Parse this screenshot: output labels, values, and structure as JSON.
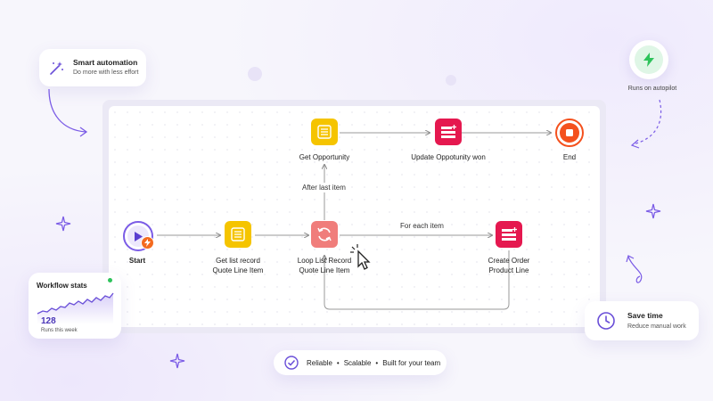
{
  "callouts": {
    "smart_automation": {
      "title": "Smart automation",
      "subtitle": "Do more with less effort"
    },
    "autopilot": {
      "label": "Runs on autopilot"
    },
    "save_time": {
      "title": "Save time",
      "subtitle": "Reduce manual work"
    },
    "stats": {
      "title": "Workflow stats",
      "value": "128",
      "caption": "Runs this week"
    }
  },
  "footer_pill": {
    "items": [
      "Reliable",
      "Scalable",
      "Built for your team"
    ],
    "separator": "•"
  },
  "flow": {
    "nodes": {
      "start": "Start",
      "get_list": [
        "Get list record",
        "Quote Line Item"
      ],
      "loop": [
        "Loop List Record",
        "Quote Line Item"
      ],
      "create_order": [
        "Create Order",
        "Product Line"
      ],
      "get_opportunity": "Get Opportunity",
      "update_opportunity": "Update Oppotunity won",
      "end": "End"
    },
    "edges": {
      "after_last": "After last item",
      "for_each": "For each item"
    }
  },
  "colors": {
    "accent": "#7b5ce6",
    "yellow": "#f5c400",
    "pink": "#e5184f",
    "salmon": "#f07d7b",
    "end_orange": "#f4511e",
    "green": "#2ec35b"
  }
}
